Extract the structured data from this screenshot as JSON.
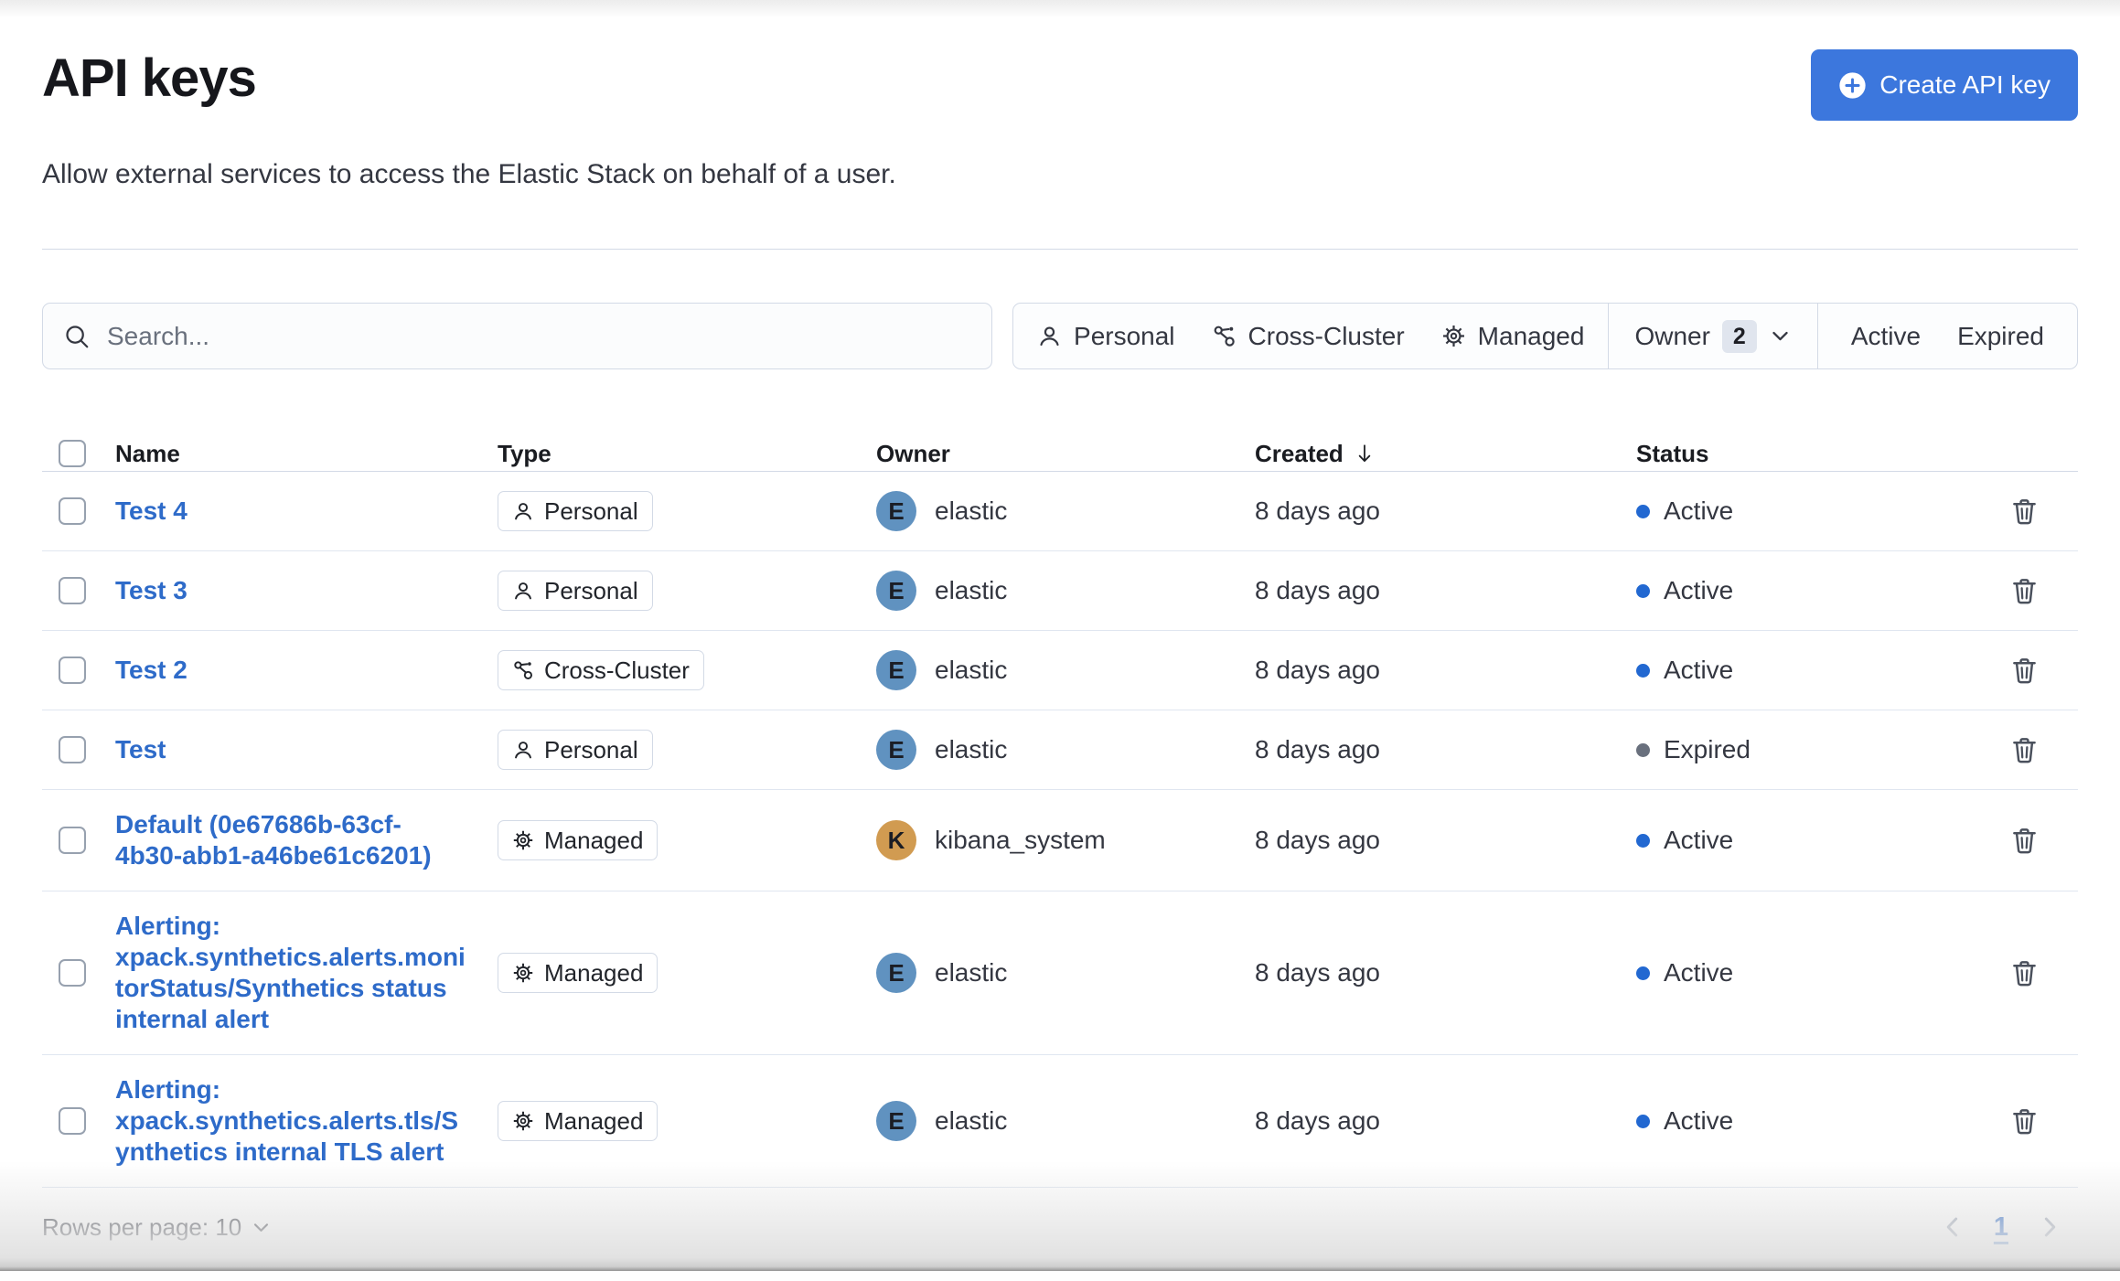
{
  "page": {
    "title": "API keys",
    "subtitle": "Allow external services to access the Elastic Stack on behalf of a user.",
    "create_button_label": "Create API key"
  },
  "search": {
    "placeholder": "Search..."
  },
  "filters": {
    "personal_label": "Personal",
    "cross_cluster_label": "Cross-Cluster",
    "managed_label": "Managed",
    "owner_label": "Owner",
    "owner_count": "2",
    "active_label": "Active",
    "expired_label": "Expired"
  },
  "table": {
    "columns": {
      "name": "Name",
      "type": "Type",
      "owner": "Owner",
      "created": "Created",
      "status": "Status"
    },
    "sort": {
      "column": "Created",
      "direction": "descending"
    },
    "rows": [
      {
        "name": "Test 4",
        "type": "Personal",
        "owner": "elastic",
        "owner_initial": "E",
        "created": "8 days ago",
        "status": "Active"
      },
      {
        "name": "Test 3",
        "type": "Personal",
        "owner": "elastic",
        "owner_initial": "E",
        "created": "8 days ago",
        "status": "Active"
      },
      {
        "name": "Test 2",
        "type": "Cross-Cluster",
        "owner": "elastic",
        "owner_initial": "E",
        "created": "8 days ago",
        "status": "Active"
      },
      {
        "name": "Test",
        "type": "Personal",
        "owner": "elastic",
        "owner_initial": "E",
        "created": "8 days ago",
        "status": "Expired"
      },
      {
        "name": "Default (0e67686b-63cf-4b30-abb1-a46be61c6201)",
        "type": "Managed",
        "owner": "kibana_system",
        "owner_initial": "K",
        "created": "8 days ago",
        "status": "Active"
      },
      {
        "name": "Alerting: xpack.synthetics.alerts.monitorStatus/Synthetics status internal alert",
        "type": "Managed",
        "owner": "elastic",
        "owner_initial": "E",
        "created": "8 days ago",
        "status": "Active"
      },
      {
        "name": "Alerting: xpack.synthetics.alerts.tls/Synthetics internal TLS alert",
        "type": "Managed",
        "owner": "elastic",
        "owner_initial": "E",
        "created": "8 days ago",
        "status": "Active"
      }
    ]
  },
  "footer": {
    "rows_per_page_label": "Rows per page: 10",
    "current_page": "1"
  },
  "colors": {
    "primary_button": "#3c77dd",
    "link": "#2e6bc9",
    "active_dot": "#2268d1",
    "expired_dot": "#69707d",
    "avatar_elastic": "#6092c0",
    "avatar_kibana_system": "#d19b51",
    "border": "#d3dae6",
    "text": "#343741"
  },
  "icons": {
    "create_button": "plus-in-circle-icon",
    "search": "search-icon",
    "personal": "user-icon",
    "cross_cluster": "cluster-icon",
    "managed": "gear-icon",
    "owner_dropdown": "chevron-down-icon",
    "sort": "arrow-down-icon",
    "delete": "trash-icon",
    "previous_page": "chevron-left-icon",
    "next_page": "chevron-right-icon"
  }
}
